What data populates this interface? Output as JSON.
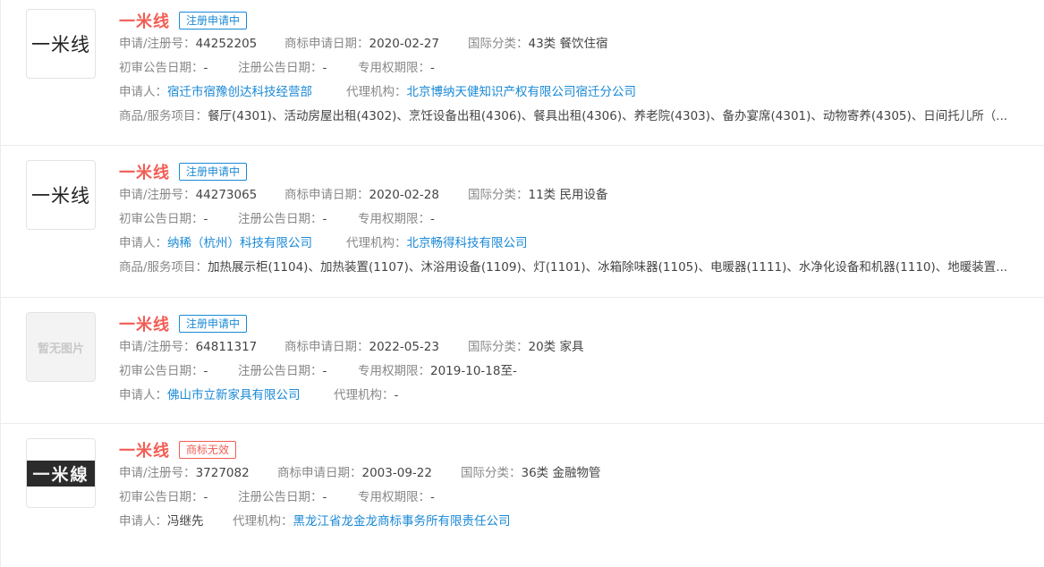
{
  "labels": {
    "reg_no": "申请/注册号：",
    "apply_date": "商标申请日期：",
    "intl_class": "国际分类：",
    "prelim_date": "初审公告日期：",
    "reg_date": "注册公告日期：",
    "exclusive_period": "专用权期限：",
    "applicant": "申请人：",
    "agency": "代理机构：",
    "goods": "商品/服务项目："
  },
  "records": [
    {
      "name": "一米线",
      "status": "注册申请中",
      "thumb_text": "一米线",
      "reg_no": "44252205",
      "apply_date": "2020-02-27",
      "intl_class": "43类 餐饮住宿",
      "prelim_date": "-",
      "reg_date": "-",
      "exclusive_period": "-",
      "applicant": "宿迁市宿豫创达科技经营部",
      "agency": "北京博纳天健知识产权有限公司宿迁分公司",
      "goods": "餐厅(4301)、活动房屋出租(4302)、烹饪设备出租(4306)、餐具出租(4306)、养老院(4303)、备办宴席(4301)、动物寄养(4305)、日间托儿所（..."
    },
    {
      "name": "一米线",
      "status": "注册申请中",
      "thumb_text": "一米线",
      "reg_no": "44273065",
      "apply_date": "2020-02-28",
      "intl_class": "11类 民用设备",
      "prelim_date": "-",
      "reg_date": "-",
      "exclusive_period": "-",
      "applicant": "纳稀（杭州）科技有限公司",
      "agency": "北京畅得科技有限公司",
      "goods": "加热展示柜(1104)、加热装置(1107)、沐浴用设备(1109)、灯(1101)、冰箱除味器(1105)、电暖器(1111)、水净化设备和机器(1110)、地暖装置..."
    },
    {
      "name": "一米线",
      "status": "注册申请中",
      "thumb_text": "暂无图片",
      "reg_no": "64811317",
      "apply_date": "2022-05-23",
      "intl_class": "20类 家具",
      "prelim_date": "-",
      "reg_date": "-",
      "exclusive_period": "2019-10-18至-",
      "applicant": "佛山市立新家具有限公司",
      "agency": "-"
    },
    {
      "name": "一米线",
      "status": "商标无效",
      "thumb_text": "一米線",
      "reg_no": "3727082",
      "apply_date": "2003-09-22",
      "intl_class": "36类 金融物管",
      "prelim_date": "-",
      "reg_date": "-",
      "exclusive_period": "-",
      "applicant": "冯继先",
      "agency": "黑龙江省龙金龙商标事务所有限责任公司"
    }
  ]
}
